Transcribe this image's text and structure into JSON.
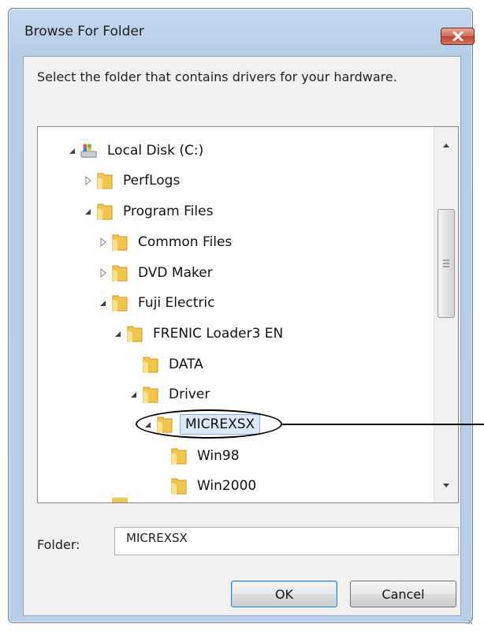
{
  "dialog": {
    "title": "Browse For Folder",
    "instruction": "Select the folder that contains drivers for your hardware.",
    "folder_label": "Folder:",
    "folder_value": "MICREXSX",
    "ok_label": "OK",
    "cancel_label": "Cancel"
  },
  "tree": {
    "items": [
      {
        "label": "Local Disk (C:)",
        "expander": "expanded",
        "icon": "drive-icon"
      },
      {
        "label": "PerfLogs",
        "expander": "collapsed",
        "icon": "folder-icon"
      },
      {
        "label": "Program Files",
        "expander": "expanded",
        "icon": "folder-icon"
      },
      {
        "label": "Common Files",
        "expander": "collapsed",
        "icon": "folder-icon"
      },
      {
        "label": "DVD Maker",
        "expander": "collapsed",
        "icon": "folder-icon"
      },
      {
        "label": "Fuji Electric",
        "expander": "expanded",
        "icon": "folder-icon"
      },
      {
        "label": "FRENIC Loader3 EN",
        "expander": "expanded",
        "icon": "folder-icon"
      },
      {
        "label": "DATA",
        "expander": "none",
        "icon": "folder-icon"
      },
      {
        "label": "Driver",
        "expander": "expanded",
        "icon": "folder-icon"
      },
      {
        "label": "MICREXSX",
        "expander": "expanded",
        "icon": "folder-icon",
        "selected": true
      },
      {
        "label": "Win98",
        "expander": "none",
        "icon": "folder-icon"
      },
      {
        "label": "Win2000",
        "expander": "none",
        "icon": "folder-icon"
      }
    ]
  },
  "colors": {
    "frame": "#b9cfe9",
    "close_button": "#c1432d",
    "selection": "#dbe8f8",
    "folder_yellow": "#f3c54a"
  }
}
